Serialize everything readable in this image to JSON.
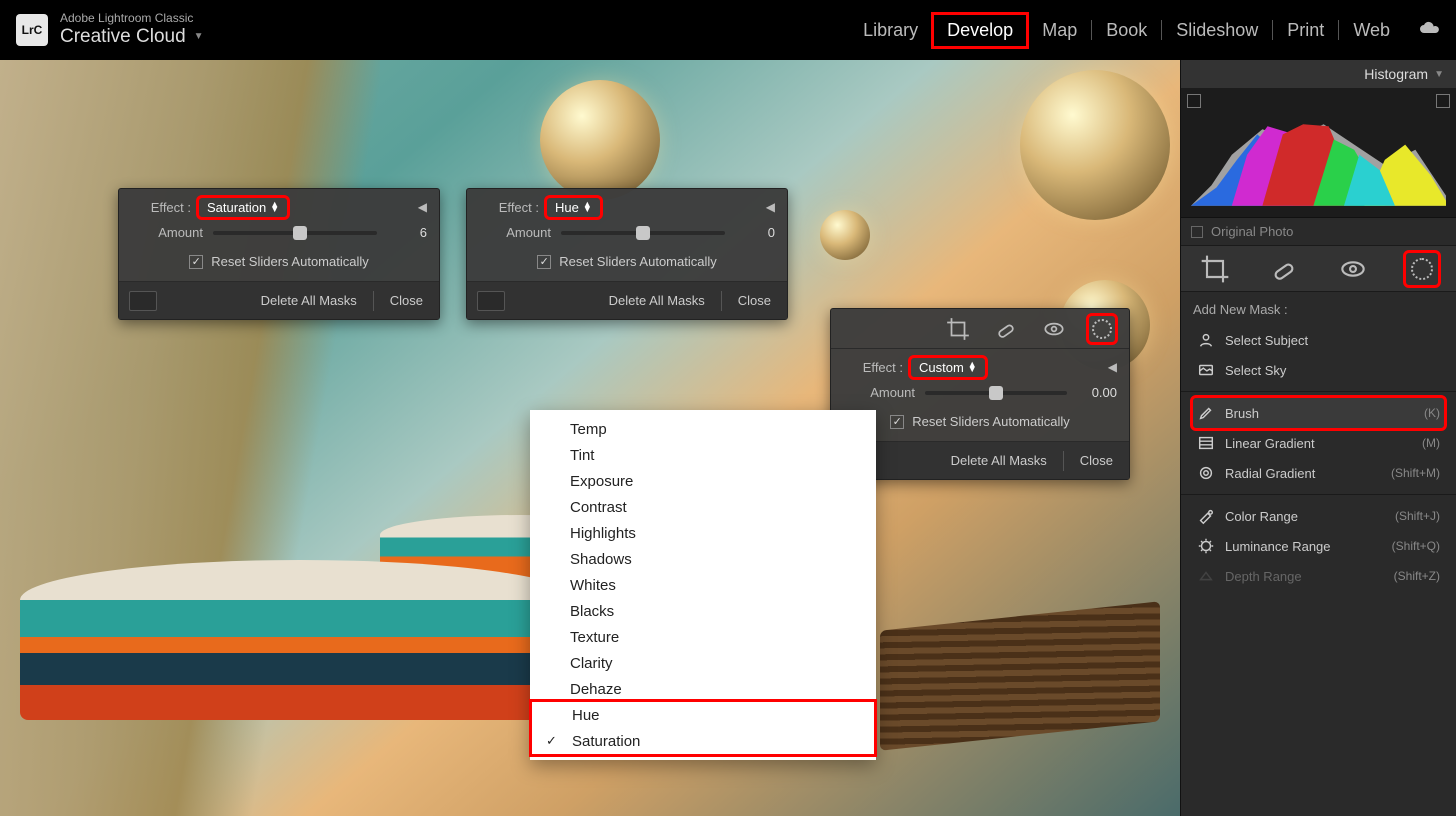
{
  "app": {
    "line1": "Adobe Lightroom Classic",
    "line2": "Creative Cloud",
    "logo": "LrC"
  },
  "nav": {
    "items": [
      "Library",
      "Develop",
      "Map",
      "Book",
      "Slideshow",
      "Print",
      "Web"
    ],
    "active_index": 1
  },
  "sidebar": {
    "histogram_label": "Histogram",
    "original_photo": "Original Photo",
    "add_mask_label": "Add New Mask :",
    "mask_items": [
      {
        "label": "Select Subject",
        "kbd": "",
        "icon": "subject"
      },
      {
        "label": "Select Sky",
        "kbd": "",
        "icon": "sky"
      }
    ],
    "mask_tools": [
      {
        "label": "Brush",
        "kbd": "(K)",
        "icon": "brush",
        "highlight": true
      },
      {
        "label": "Linear Gradient",
        "kbd": "(M)",
        "icon": "linear"
      },
      {
        "label": "Radial Gradient",
        "kbd": "(Shift+M)",
        "icon": "radial"
      }
    ],
    "mask_ranges": [
      {
        "label": "Color Range",
        "kbd": "(Shift+J)",
        "icon": "color"
      },
      {
        "label": "Luminance Range",
        "kbd": "(Shift+Q)",
        "icon": "lum"
      },
      {
        "label": "Depth Range",
        "kbd": "(Shift+Z)",
        "icon": "depth",
        "dim": true
      }
    ]
  },
  "panels": {
    "effect_label": "Effect :",
    "amount_label": "Amount",
    "reset_label": "Reset Sliders Automatically",
    "delete_all": "Delete All Masks",
    "close": "Close",
    "p1": {
      "select": "Saturation",
      "amount": "6",
      "knob_pct": 53
    },
    "p2": {
      "select": "Hue",
      "amount": "0",
      "knob_pct": 50
    },
    "p3": {
      "select": "Custom",
      "amount": "0.00",
      "knob_pct": 50
    }
  },
  "dropdown": {
    "items": [
      "Temp",
      "Tint",
      "Exposure",
      "Contrast",
      "Highlights",
      "Shadows",
      "Whites",
      "Blacks",
      "Texture",
      "Clarity",
      "Dehaze",
      "Hue",
      "Saturation"
    ],
    "checked_index": 12,
    "highlight_from": 11
  }
}
